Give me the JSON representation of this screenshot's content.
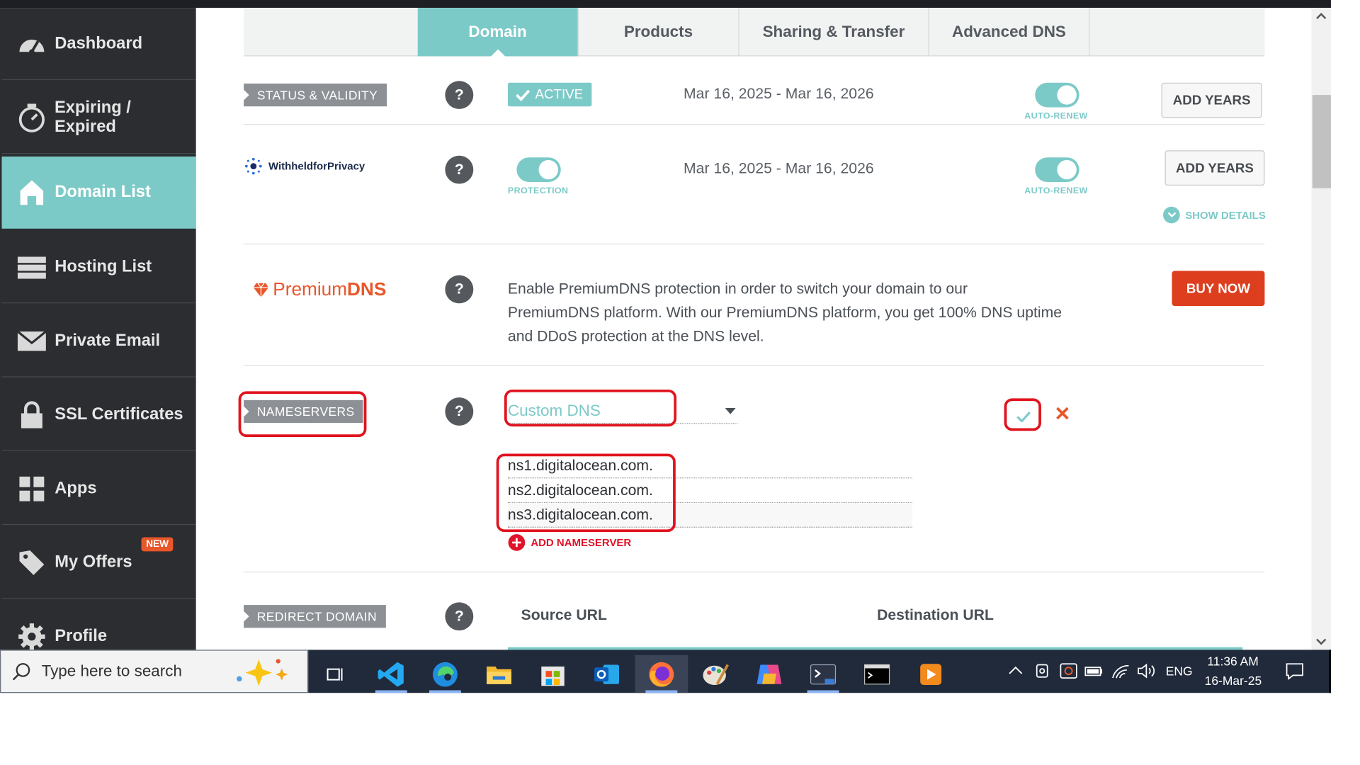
{
  "sidebar": {
    "items": [
      {
        "label": "Dashboard",
        "icon": "speedometer-icon"
      },
      {
        "label": "Expiring / Expired",
        "icon": "timer-icon"
      },
      {
        "label": "Domain List",
        "icon": "home-icon"
      },
      {
        "label": "Hosting List",
        "icon": "server-icon"
      },
      {
        "label": "Private Email",
        "icon": "envelope-icon"
      },
      {
        "label": "SSL Certificates",
        "icon": "lock-icon"
      },
      {
        "label": "Apps",
        "icon": "apps-icon"
      },
      {
        "label": "My Offers",
        "icon": "tag-icon"
      },
      {
        "label": "Profile",
        "icon": "gear-icon"
      }
    ],
    "new_badge": "NEW"
  },
  "tabs": [
    "Domain",
    "Products",
    "Sharing & Transfer",
    "Advanced DNS"
  ],
  "status_row": {
    "label": "STATUS & VALIDITY",
    "badge": "ACTIVE",
    "dates": "Mar 16, 2025 - Mar 16, 2026",
    "auto_renew_label": "AUTO-RENEW",
    "button": "ADD YEARS"
  },
  "privacy_row": {
    "logo_text": "WithheldforPrivacy",
    "protection_label": "PROTECTION",
    "dates": "Mar 16, 2025 - Mar 16, 2026",
    "auto_renew_label": "AUTO-RENEW",
    "button": "ADD YEARS",
    "show_details": "SHOW DETAILS"
  },
  "premium_row": {
    "logo_prefix": "Premium",
    "logo_suffix": "DNS",
    "description_lines": [
      "Enable PremiumDNS protection in order to switch your domain to our",
      "PremiumDNS platform. With our PremiumDNS platform, you get 100% DNS uptime",
      "and DDoS protection at the DNS level."
    ],
    "button": "BUY NOW"
  },
  "nameservers_row": {
    "label": "NAMESERVERS",
    "select_value": "Custom DNS",
    "servers": [
      "ns1.digitalocean.com.",
      "ns2.digitalocean.com.",
      "ns3.digitalocean.com."
    ],
    "add_label": "ADD NAMESERVER"
  },
  "redirect_row": {
    "label": "REDIRECT DOMAIN",
    "source_header": "Source URL",
    "destination_header": "Destination URL"
  },
  "question_mark": "?",
  "taskbar": {
    "search_placeholder": "Type here to search",
    "language": "ENG",
    "time": "11:36 AM",
    "date": "16-Mar-25"
  },
  "colors": {
    "accent": "#7ccac8",
    "sidebar_bg": "#2b2d31",
    "red_highlight": "#e0141e",
    "buy_now": "#dd3f1e",
    "premium_orange": "#e8562a"
  }
}
